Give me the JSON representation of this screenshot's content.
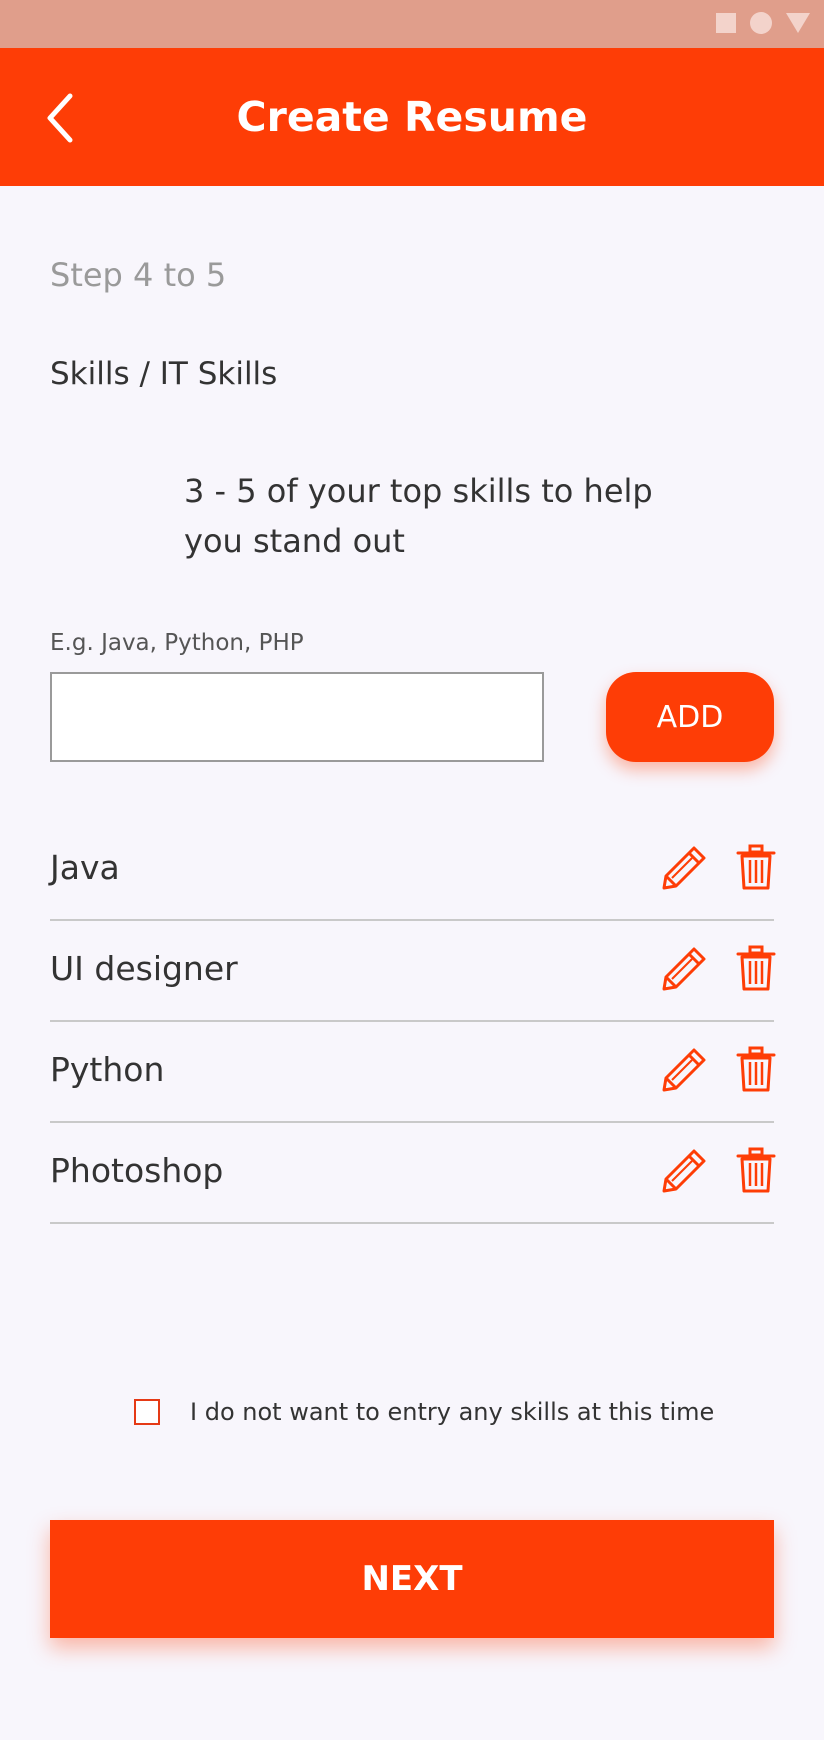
{
  "header": {
    "title": "Create Resume",
    "back_icon": "chevron-left-icon"
  },
  "step": {
    "label": "Step 4 to 5"
  },
  "section": {
    "title": "Skills / IT Skills"
  },
  "description": "3 - 5 of your top skills to help you stand out",
  "input": {
    "label": "E.g. Java, Python, PHP",
    "value": "",
    "placeholder": ""
  },
  "add_button": {
    "label": "ADD"
  },
  "skills": [
    {
      "name": "Java"
    },
    {
      "name": "UI designer"
    },
    {
      "name": "Python"
    },
    {
      "name": "Photoshop"
    }
  ],
  "opt_out": {
    "label": "I do not want to entry any skills at this time",
    "checked": false
  },
  "next_button": {
    "label": "NEXT"
  },
  "colors": {
    "accent": "#fe3d06",
    "status_bar": "#e09e8b",
    "background": "#f8f6fc",
    "text": "#333333"
  }
}
